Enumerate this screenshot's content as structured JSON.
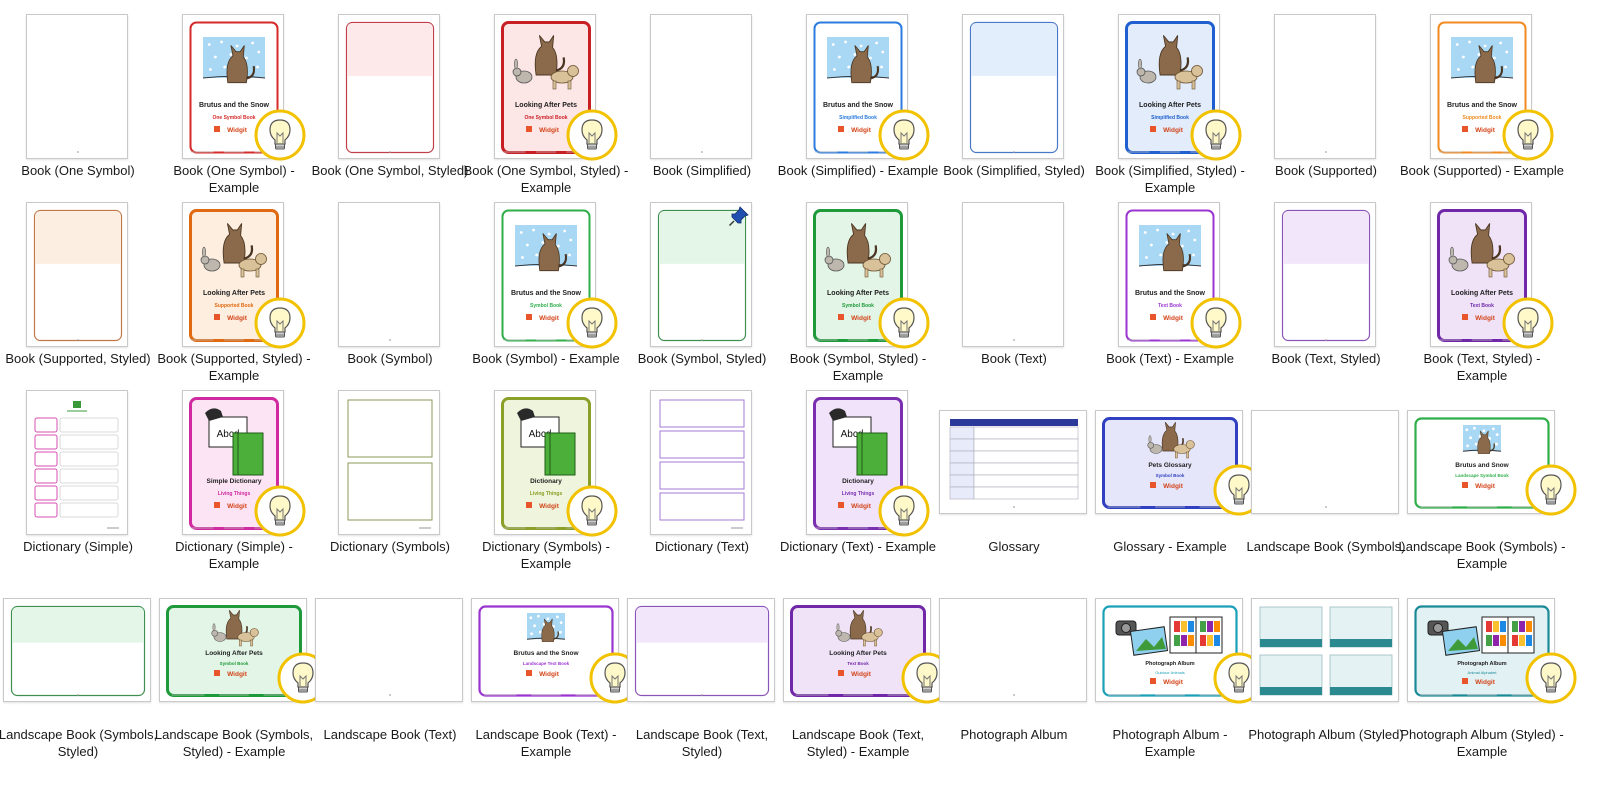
{
  "tiles": [
    {
      "label": "Book (One Symbol)",
      "orient": "portrait",
      "kind": "blank",
      "color": "#000000",
      "example": false
    },
    {
      "label": "Book (One Symbol) - Example",
      "orient": "portrait",
      "kind": "cover-snow",
      "color": "#d42a2a",
      "fill": "#ffffff",
      "title": "Brutus and the Snow",
      "subtitle": "One Symbol Book",
      "example": true
    },
    {
      "label": "Book (One Symbol, Styled)",
      "orient": "portrait",
      "kind": "styled",
      "color": "#c0404a",
      "fill": "#fde8ea",
      "example": false
    },
    {
      "label": "Book (One Symbol, Styled) - Example",
      "orient": "portrait",
      "kind": "cover-pets",
      "color": "#c81f25",
      "fill": "#fde6e6",
      "title": "Looking After Pets",
      "subtitle": "One Symbol Book",
      "example": true
    },
    {
      "label": "Book (Simplified)",
      "orient": "portrait",
      "kind": "blank",
      "color": "#000000",
      "example": false
    },
    {
      "label": "Book (Simplified) - Example",
      "orient": "portrait",
      "kind": "cover-snow",
      "color": "#2b7be0",
      "fill": "#ffffff",
      "title": "Brutus and the Snow",
      "subtitle": "Simplified Book",
      "example": true
    },
    {
      "label": "Book (Simplified, Styled)",
      "orient": "portrait",
      "kind": "styled",
      "color": "#4a78c8",
      "fill": "#e3eefc",
      "example": false
    },
    {
      "label": "Book (Simplified, Styled) - Example",
      "orient": "portrait",
      "kind": "cover-pets",
      "color": "#1f5fcf",
      "fill": "#e2ecfb",
      "title": "Looking After Pets",
      "subtitle": "Simplified Book",
      "example": true
    },
    {
      "label": "Book (Supported)",
      "orient": "portrait",
      "kind": "blank",
      "color": "#000000",
      "example": false
    },
    {
      "label": "Book (Supported) - Example",
      "orient": "portrait",
      "kind": "cover-snow",
      "color": "#f08a20",
      "fill": "#ffffff",
      "title": "Brutus and the Snow",
      "subtitle": "Supported Book",
      "example": true
    },
    {
      "label": "Book (Supported, Styled)",
      "orient": "portrait",
      "kind": "styled",
      "color": "#c07848",
      "fill": "#fdeee2",
      "example": false
    },
    {
      "label": "Book (Supported, Styled) - Example",
      "orient": "portrait",
      "kind": "cover-pets",
      "color": "#e06a12",
      "fill": "#fdeee0",
      "title": "Looking After Pets",
      "subtitle": "Supported Book",
      "example": true
    },
    {
      "label": "Book (Symbol)",
      "orient": "portrait",
      "kind": "blank",
      "color": "#000000",
      "example": false
    },
    {
      "label": "Book (Symbol) - Example",
      "orient": "portrait",
      "kind": "cover-snow",
      "color": "#2fae4a",
      "fill": "#ffffff",
      "title": "Brutus and the Snow",
      "subtitle": "Symbol Book",
      "example": true
    },
    {
      "label": "Book (Symbol, Styled)",
      "orient": "portrait",
      "kind": "styled",
      "color": "#3f8f50",
      "fill": "#e4f6e8",
      "example": false,
      "pinned": true
    },
    {
      "label": "Book (Symbol, Styled) - Example",
      "orient": "portrait",
      "kind": "cover-pets",
      "color": "#1e9a3a",
      "fill": "#e3f5e6",
      "title": "Looking After Pets",
      "subtitle": "Symbol Book",
      "example": true
    },
    {
      "label": "Book (Text)",
      "orient": "portrait",
      "kind": "blank",
      "color": "#000000",
      "example": false
    },
    {
      "label": "Book (Text) - Example",
      "orient": "portrait",
      "kind": "cover-snow",
      "color": "#9a35d0",
      "fill": "#ffffff",
      "title": "Brutus and the Snow",
      "subtitle": "Text Book",
      "example": true
    },
    {
      "label": "Book (Text, Styled)",
      "orient": "portrait",
      "kind": "styled",
      "color": "#8a55b8",
      "fill": "#f1e6fa",
      "example": false
    },
    {
      "label": "Book (Text, Styled) - Example",
      "orient": "portrait",
      "kind": "cover-pets",
      "color": "#7028a8",
      "fill": "#f0e3f8",
      "title": "Looking After Pets",
      "subtitle": "Text Book",
      "example": true
    },
    {
      "label": "Dictionary (Simple)",
      "orient": "portrait",
      "kind": "dict-simple",
      "color": "#d64fb0",
      "example": false
    },
    {
      "label": "Dictionary (Simple) - Example",
      "orient": "portrait",
      "kind": "cover-dict",
      "color": "#d02aa0",
      "fill": "#fde4f4",
      "title": "Simple Dictionary",
      "subtitle": "Living Things",
      "example": true
    },
    {
      "label": "Dictionary (Symbols)",
      "orient": "portrait",
      "kind": "dict-symbols",
      "color": "#8a9a5a",
      "example": false
    },
    {
      "label": "Dictionary (Symbols) - Example",
      "orient": "portrait",
      "kind": "cover-dict",
      "color": "#8aa028",
      "fill": "#eef5dc",
      "title": "Dictionary",
      "subtitle": "Living Things",
      "example": true
    },
    {
      "label": "Dictionary (Text)",
      "orient": "portrait",
      "kind": "dict-text",
      "color": "#a67ad6",
      "example": false
    },
    {
      "label": "Dictionary (Text) - Example",
      "orient": "portrait",
      "kind": "cover-dict",
      "color": "#7a2fb0",
      "fill": "#f1e4fa",
      "title": "Dictionary",
      "subtitle": "Living Things",
      "example": true
    },
    {
      "label": "Glossary",
      "orient": "landscape",
      "kind": "glossary",
      "color": "#2b3a9a",
      "example": false
    },
    {
      "label": "Glossary - Example",
      "orient": "landscape",
      "kind": "cover-pets",
      "color": "#3040c0",
      "fill": "#e6e6fb",
      "title": "Pets Glossary",
      "subtitle": "Symbol Book",
      "example": true
    },
    {
      "label": "Landscape Book (Symbols)",
      "orient": "landscape",
      "kind": "blank",
      "color": "#000000",
      "example": false
    },
    {
      "label": "Landscape Book (Symbols) - Example",
      "orient": "landscape",
      "kind": "cover-snow",
      "color": "#2fae4a",
      "fill": "#ffffff",
      "title": "Brutus and Snow",
      "subtitle": "Landscape Symbol Book",
      "example": true
    },
    {
      "label": "Landscape Book (Symbols, Styled)",
      "orient": "landscape",
      "kind": "styled",
      "color": "#3f8f50",
      "fill": "#e4f6e8",
      "example": false
    },
    {
      "label": "Landscape Book (Symbols, Styled) - Example",
      "orient": "landscape",
      "kind": "cover-pets",
      "color": "#1e9a3a",
      "fill": "#e3f5e6",
      "title": "Looking After Pets",
      "subtitle": "Symbol Book",
      "example": true
    },
    {
      "label": "Landscape Book (Text)",
      "orient": "landscape",
      "kind": "blank",
      "color": "#000000",
      "example": false
    },
    {
      "label": "Landscape Book (Text) - Example",
      "orient": "landscape",
      "kind": "cover-snow",
      "color": "#9a35d0",
      "fill": "#ffffff",
      "title": "Brutus and the Snow",
      "subtitle": "Landscape Text Book",
      "example": true
    },
    {
      "label": "Landscape Book (Text, Styled)",
      "orient": "landscape",
      "kind": "styled",
      "color": "#8a55b8",
      "fill": "#f1e6fa",
      "example": false
    },
    {
      "label": "Landscape Book (Text, Styled) - Example",
      "orient": "landscape",
      "kind": "cover-pets",
      "color": "#7028a8",
      "fill": "#f0e3f8",
      "title": "Looking After Pets",
      "subtitle": "Text Book",
      "example": true
    },
    {
      "label": "Photograph Album",
      "orient": "landscape",
      "kind": "blank",
      "color": "#000000",
      "example": false
    },
    {
      "label": "Photograph Album - Example",
      "orient": "landscape",
      "kind": "cover-photo",
      "color": "#1aa0b8",
      "fill": "#ffffff",
      "title": "Photograph Album",
      "subtitle": "Outdoor Animals",
      "example": true
    },
    {
      "label": "Photograph Album (Styled)",
      "orient": "landscape",
      "kind": "photo-styled",
      "color": "#2a8a90",
      "fill": "#e4f2f4",
      "example": false
    },
    {
      "label": "Photograph Album (Styled) - Example",
      "orient": "landscape",
      "kind": "cover-photo",
      "color": "#1a8a96",
      "fill": "#e2f2f4",
      "title": "Photograph Album",
      "subtitle": "Animal Alphabet",
      "example": true
    }
  ],
  "widgit_label": "Widgit",
  "dict_cover_text": "Abcd",
  "icons": {
    "bulb": "lightbulb-icon",
    "pin": "pin-icon"
  }
}
